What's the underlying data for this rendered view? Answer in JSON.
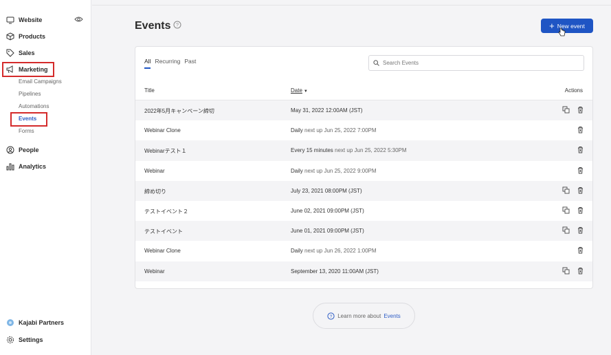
{
  "sidebar": {
    "items": [
      {
        "label": "Website",
        "icon": "monitor-icon"
      },
      {
        "label": "Products",
        "icon": "box-icon"
      },
      {
        "label": "Sales",
        "icon": "tag-icon"
      },
      {
        "label": "Marketing",
        "icon": "megaphone-icon"
      },
      {
        "label": "People",
        "icon": "person-circle-icon"
      },
      {
        "label": "Analytics",
        "icon": "bar-chart-icon"
      }
    ],
    "marketing_sub": [
      "Email Campaigns",
      "Pipelines",
      "Automations",
      "Events",
      "Forms"
    ],
    "bottom": [
      {
        "label": "Kajabi Partners",
        "icon": "partners-icon"
      },
      {
        "label": "Settings",
        "icon": "gear-icon"
      }
    ],
    "highlight_color": "#d42a2a"
  },
  "header": {
    "title": "Events",
    "new_event_label": "New event",
    "accent": "#1f55c4"
  },
  "events": {
    "tabs": [
      "All",
      "Recurring",
      "Past"
    ],
    "active_tab": "All",
    "search_placeholder": "Search Events",
    "columns": {
      "title": "Title",
      "date": "Date",
      "actions": "Actions"
    },
    "rows": [
      {
        "title": "2022年5月キャンペーン締切",
        "date_main": "May 31, 2022 12:00AM (JST)",
        "date_rest": "",
        "copy": true
      },
      {
        "title": "Webinar Clone",
        "date_main": "Daily",
        "date_rest": " next up Jun 25, 2022 7:00PM",
        "copy": false
      },
      {
        "title": "Webinarテスト１",
        "date_main": "Every 15 minutes",
        "date_rest": " next up Jun 25, 2022 5:30PM",
        "copy": false
      },
      {
        "title": "Webinar",
        "date_main": "Daily",
        "date_rest": " next up Jun 25, 2022 9:00PM",
        "copy": false
      },
      {
        "title": "締め切り",
        "date_main": "July 23, 2021 08:00PM (JST)",
        "date_rest": "",
        "copy": true
      },
      {
        "title": "テストイベント２",
        "date_main": "June 02, 2021 09:00PM (JST)",
        "date_rest": "",
        "copy": true
      },
      {
        "title": "テストイベント",
        "date_main": "June 01, 2021 09:00PM (JST)",
        "date_rest": "",
        "copy": true
      },
      {
        "title": "Webinar Clone",
        "date_main": "Daily",
        "date_rest": " next up Jun 26, 2022 1:00PM",
        "copy": false
      },
      {
        "title": "Webinar",
        "date_main": "September 13, 2020 11:00AM (JST)",
        "date_rest": "",
        "copy": true
      }
    ]
  },
  "footer": {
    "learn_text": "Learn more about ",
    "learn_link": "Events"
  }
}
